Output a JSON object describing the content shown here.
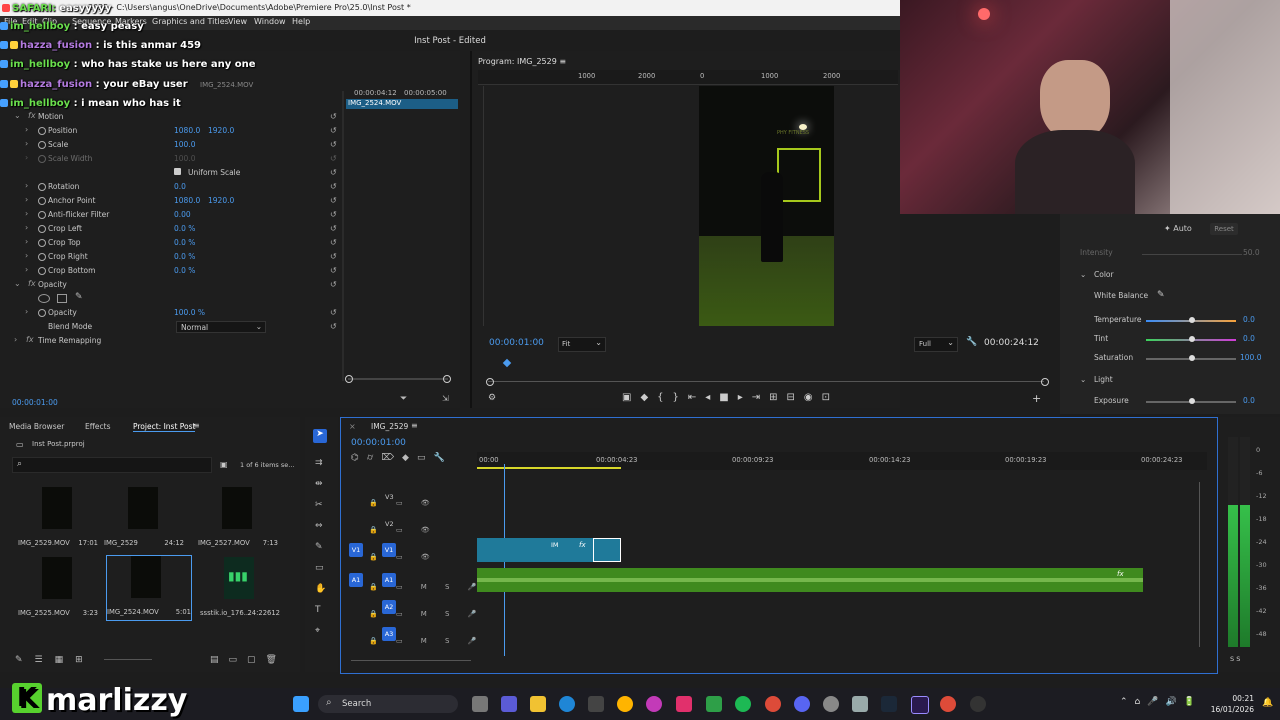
{
  "window": {
    "title_path": "2025 - C:\\Users\\angus\\OneDrive\\Documents\\Adobe\\Premiere Pro\\25.0\\Inst Post *",
    "document_title": "Inst Post - Edited"
  },
  "menu": [
    "File",
    "Edit",
    "Clip",
    "Sequence",
    "Markers",
    "Graphics and Titles",
    "View",
    "Window",
    "Help"
  ],
  "chat": [
    {
      "user": "SAFARI: ",
      "text": "easyyyyy",
      "color": "u"
    },
    {
      "user": "im_hellboy",
      "text": " : easy peasy",
      "color": "u"
    },
    {
      "user": "hazza_fusion",
      "text": " : is this anmar 459",
      "color": "u2"
    },
    {
      "user": "im_hellboy",
      "text": " : who has stake us here any one",
      "color": "u"
    },
    {
      "user": "hazza_fusion",
      "text": " : your eBay user",
      "color": "u2"
    },
    {
      "user": "im_hellboy",
      "text": " : i mean who has it",
      "color": "u"
    }
  ],
  "effect_controls": {
    "clip_tag": "IMG_2524.MOV",
    "clip_bar": "IMG_2524.MOV",
    "ruler": [
      "00:00:04:12",
      "00:00:05:00"
    ],
    "timecode": "00:00:01:00",
    "sections": {
      "motion": "Motion",
      "opacity": "Opacity",
      "time_remap": "Time Remapping"
    },
    "props": [
      {
        "label": "Position",
        "v1": "1080.0",
        "v2": "1920.0"
      },
      {
        "label": "Scale",
        "v1": "100.0",
        "v2": ""
      },
      {
        "label": "Scale Width",
        "v1": "100.0",
        "v2": ""
      },
      {
        "label": "Uniform Scale",
        "v1": "",
        "v2": ""
      },
      {
        "label": "Rotation",
        "v1": "0.0",
        "v2": ""
      },
      {
        "label": "Anchor Point",
        "v1": "1080.0",
        "v2": "1920.0"
      },
      {
        "label": "Anti-flicker Filter",
        "v1": "0.00",
        "v2": ""
      },
      {
        "label": "Crop Left",
        "v1": "0.0 %",
        "v2": ""
      },
      {
        "label": "Crop Top",
        "v1": "0.0 %",
        "v2": ""
      },
      {
        "label": "Crop Right",
        "v1": "0.0 %",
        "v2": ""
      },
      {
        "label": "Crop Bottom",
        "v1": "0.0 %",
        "v2": ""
      }
    ],
    "opacity_props": [
      {
        "label": "Opacity",
        "v1": "100.0 %"
      },
      {
        "label": "Blend Mode",
        "v1": "Normal"
      }
    ]
  },
  "program": {
    "tab": "Program: IMG_2529",
    "ruler": [
      "1000",
      "2000",
      "0",
      "1000",
      "2000"
    ],
    "timecode": "00:00:01:00",
    "fit": "Fit",
    "quality": "Full",
    "duration": "00:00:24:12",
    "video_sign": "PHY FITNESS"
  },
  "lumetri": {
    "auto": "Auto",
    "reset": "Reset",
    "intensity": "Intensity",
    "intensity_val": "50.0",
    "color_header": "Color",
    "white_balance": "White Balance",
    "temperature": {
      "label": "Temperature",
      "value": "0.0"
    },
    "tint": {
      "label": "Tint",
      "value": "0.0"
    },
    "saturation": {
      "label": "Saturation",
      "value": "100.0"
    },
    "light_header": "Light",
    "exposure": {
      "label": "Exposure",
      "value": "0.0"
    }
  },
  "project": {
    "tabs": [
      "Media Browser",
      "Effects",
      "Project: Inst Post"
    ],
    "file": "Inst Post.prproj",
    "count": "1 of 6 items se...",
    "items": [
      {
        "name": "IMG_2529.MOV",
        "dur": "17:01"
      },
      {
        "name": "IMG_2529",
        "dur": "24:12"
      },
      {
        "name": "IMG_2527.MOV",
        "dur": "7:13"
      },
      {
        "name": "IMG_2525.MOV",
        "dur": "3:23"
      },
      {
        "name": "IMG_2524.MOV",
        "dur": "5:01"
      },
      {
        "name": "ssstik.io_176...",
        "dur": "24:22612"
      }
    ]
  },
  "timeline": {
    "tab": "IMG_2529",
    "timecode": "00:00:01:00",
    "ruler": [
      "00:00",
      "00:00:04:23",
      "00:00:09:23",
      "00:00:14:23",
      "00:00:19:23",
      "00:00:24:23"
    ],
    "video_tracks": [
      "V3",
      "V2",
      "V1"
    ],
    "audio_tracks": [
      "A1",
      "A2",
      "A3"
    ],
    "clip_label": "IM"
  },
  "meter": {
    "labels": [
      "0",
      "-6",
      "-12",
      "-18",
      "-24",
      "-30",
      "-36",
      "-42",
      "-48",
      "-54"
    ],
    "bottom": "S  S"
  },
  "taskbar": {
    "search": "Search",
    "time": "00:21",
    "date": "16/01/2026"
  },
  "brand": {
    "k": "K",
    "name": "marlizzy"
  },
  "colors": {
    "accent": "#2967d6",
    "value_blue": "#4b9bef",
    "audio": "#3f8a1e",
    "clip": "#1f7a9a"
  }
}
